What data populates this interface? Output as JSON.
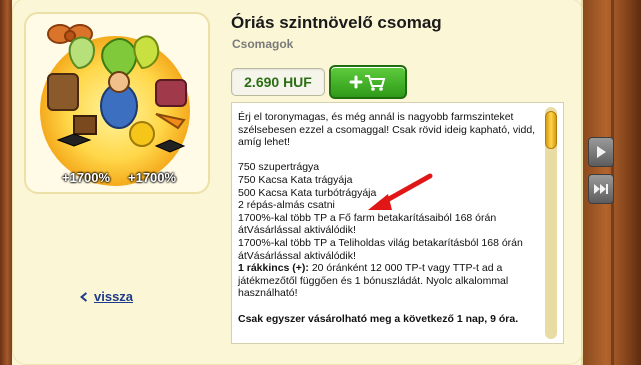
{
  "package": {
    "title": "Óriás szintnövelő csomag",
    "category": "Csomagok",
    "badge_left": "+1700%",
    "badge_right": "+1700%"
  },
  "purchase": {
    "price": "2.690 HUF",
    "buy_icon": "add-to-cart-icon"
  },
  "description": {
    "intro": "Érj el toronymagas, és még annál is nagyobb farmszinteket szélsebesen ezzel a csomaggal! Csak rövid ideig kapható, vidd, amíg lehet!",
    "items": [
      "750 szupertrágya",
      "750 Kacsa Kata trágyája",
      "500 Kacsa Kata turbótrágyája",
      "2 répás-almás csatni",
      "1700%-kal több TP a Fő farm betakarításaiból 168 órán átVásárlással aktiválódik!",
      "1700%-kal több TP a Teliholdas világ betakarításból 168 órán átVásárlással aktiválódik!"
    ],
    "rakkincs_label": "1 rákkincs (+):",
    "rakkincs_text": " 20 óránként 12 000 TP-t vagy TTP-t ad a játékmezőtől függően és 1 bónuszládát. Nyolc alkalommal használható!",
    "footer": "Csak egyszer vásárolható meg a következő 1 nap, 9 óra."
  },
  "nav": {
    "back_label": "vissza",
    "side_next_icon": "play-icon",
    "side_fast_icon": "fast-forward-icon"
  },
  "colors": {
    "price_text": "#2b6e14",
    "buy_button": "#3aa820",
    "link": "#1e3a8a",
    "arrow": "#e11616",
    "parchment": "#fbf6d6"
  }
}
